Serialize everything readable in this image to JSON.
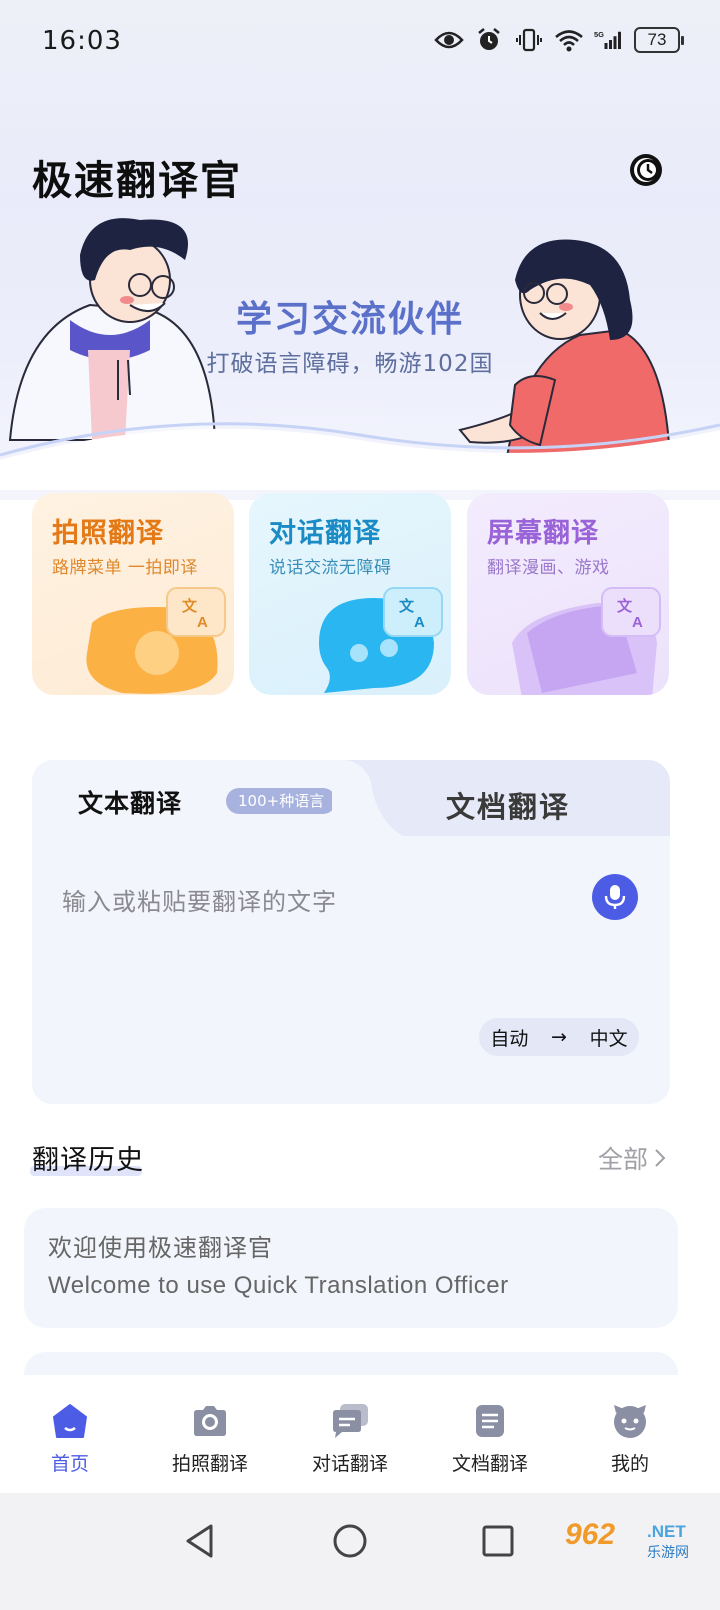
{
  "status_bar": {
    "time": "16:03",
    "battery": "73"
  },
  "app": {
    "title": "极速翻译官"
  },
  "hero": {
    "title": "学习交流伙伴",
    "subtitle": "打破语言障碍，畅游102国"
  },
  "features": [
    {
      "title": "拍照翻译",
      "subtitle": "路牌菜单 一拍即译"
    },
    {
      "title": "对话翻译",
      "subtitle": "说话交流无障碍"
    },
    {
      "title": "屏幕翻译",
      "subtitle": "翻译漫画、游戏"
    }
  ],
  "translate": {
    "tab_text": "文本翻译",
    "tab_badge": "100+种语言",
    "tab_doc": "文档翻译",
    "placeholder": "输入或粘贴要翻译的文字",
    "source_lang": "自动",
    "arrow": "→",
    "target_lang": "中文"
  },
  "history": {
    "title": "翻译历史",
    "all_label": "全部",
    "items": [
      {
        "source": "欢迎使用极速翻译官",
        "target": "Welcome to use Quick Translation Officer"
      }
    ]
  },
  "nav": {
    "items": [
      {
        "label": "首页",
        "icon": "home-icon",
        "active": true
      },
      {
        "label": "拍照翻译",
        "icon": "camera-icon"
      },
      {
        "label": "对话翻译",
        "icon": "chat-icon"
      },
      {
        "label": "文档翻译",
        "icon": "document-icon"
      },
      {
        "label": "我的",
        "icon": "profile-icon"
      }
    ]
  },
  "watermark": {
    "main": "962",
    "net": ".NET",
    "sub": "乐游网"
  },
  "colors": {
    "accent": "#4d5ce5",
    "hero_title": "#5a70c9",
    "photo": "#e37a17",
    "dialog": "#1a8bc4",
    "screen": "#9a63d8"
  }
}
